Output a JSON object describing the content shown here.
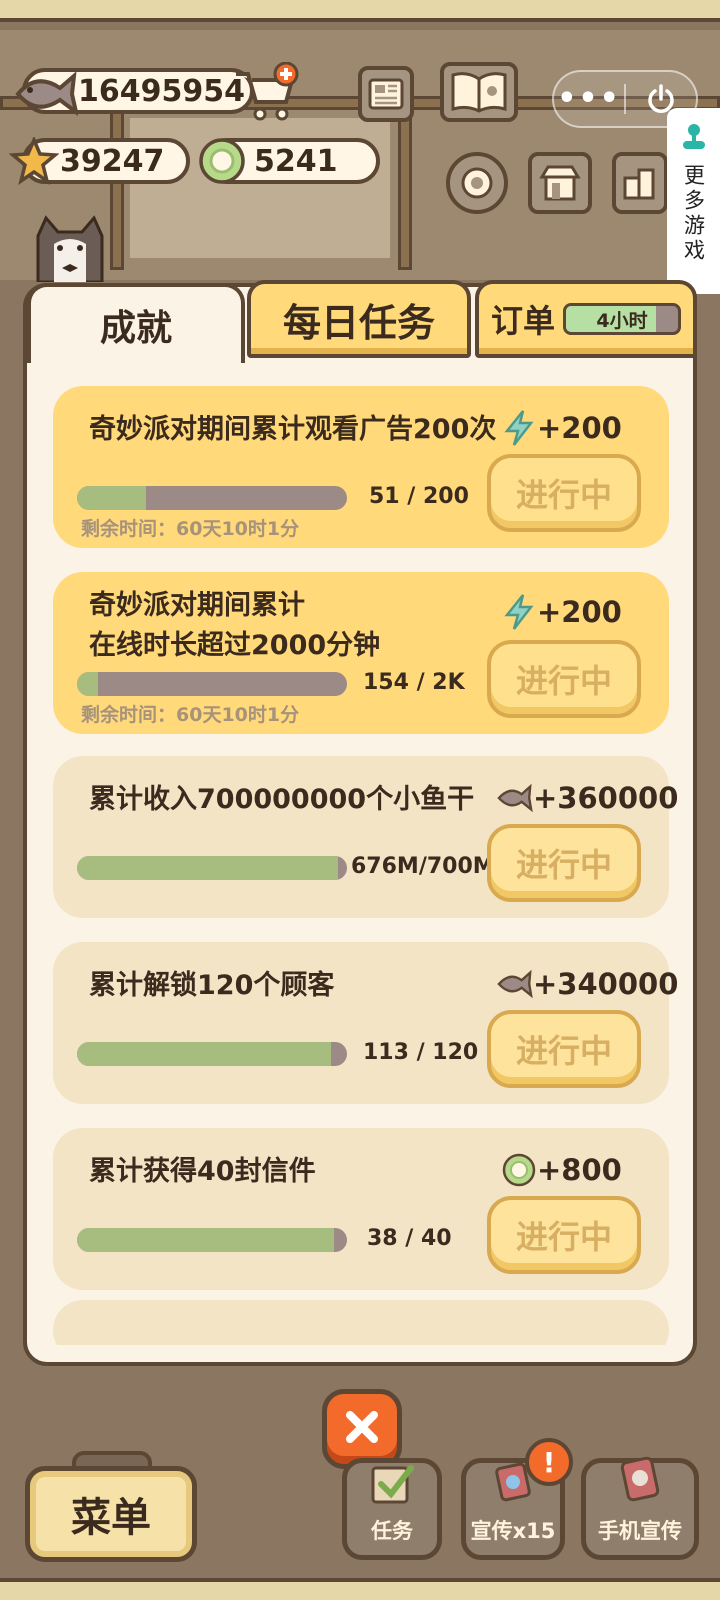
{
  "hud": {
    "fish_count": "16495954",
    "star_count": "39247",
    "coin_count": "5241"
  },
  "miniprogram": {
    "more_games_label": "更多游戏"
  },
  "tabs": {
    "achievement": "成就",
    "daily": "每日任务",
    "orders": "订单",
    "orders_timer": "4小时"
  },
  "cards": [
    {
      "title": "奇妙派对期间累计观看广告200次",
      "reward_icon": "lightning-icon",
      "reward": "+200",
      "progress_text": "51  /  200",
      "progress": 0.255,
      "remaining": "剩余时间：60天10时1分",
      "button": "进行中"
    },
    {
      "title": "奇妙派对期间累计\n在线时长超过2000分钟",
      "reward_icon": "lightning-icon",
      "reward": "+200",
      "progress_text": "154  /  2K",
      "progress": 0.077,
      "remaining": "剩余时间：60天10时1分",
      "button": "进行中"
    },
    {
      "title": "累计收入700000000个小鱼干",
      "reward_icon": "fish-icon",
      "reward": "+360000",
      "progress_text": "676M/700M",
      "progress": 0.966,
      "button": "进行中"
    },
    {
      "title": "累计解锁120个顾客",
      "reward_icon": "fish-icon",
      "reward": "+340000",
      "progress_text": "113  /  120",
      "progress": 0.942,
      "button": "进行中"
    },
    {
      "title": "累计获得40封信件",
      "reward_icon": "coin-icon",
      "reward": "+800",
      "progress_text": "38  /  40",
      "progress": 0.95,
      "button": "进行中"
    }
  ],
  "bottom": {
    "menu": "菜单",
    "tasks": "任务",
    "promo": "宣传x15",
    "phone_promo": "手机宣传",
    "badge": "!"
  },
  "colors": {
    "brown_outline": "#5c4634",
    "card_highlight": "#ffd97a",
    "card_normal": "#f3e4c6",
    "progress_fill": "#a7bd7f",
    "progress_track": "#9b8a86",
    "close_orange": "#f36b2a"
  }
}
